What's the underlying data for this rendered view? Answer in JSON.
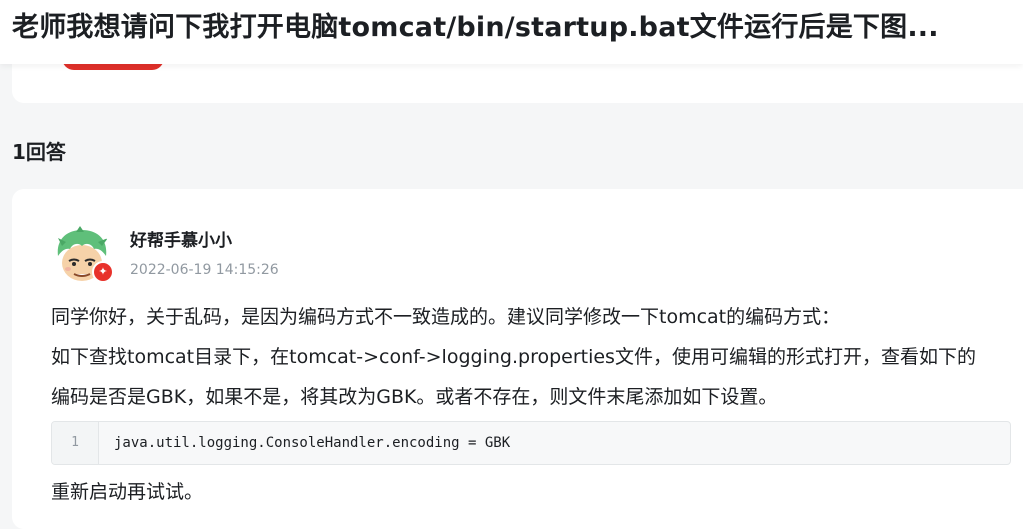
{
  "question": {
    "title": "老师我想请问下我打开电脑tomcat/bin/startup.bat文件运行后是下图..."
  },
  "answers": {
    "count_label": "1回答"
  },
  "answer": {
    "author": "好帮手慕小小",
    "time": "2022-06-19 14:15:26",
    "avatar_icon": "cartoon-avatar-icon",
    "badge_icon": "fire-badge-icon",
    "paragraphs": [
      "同学你好，关于乱码，是因为编码方式不一致造成的。建议同学修改一下tomcat的编码方式：",
      "如下查找tomcat目录下，在tomcat->conf->logging.properties文件，使用可编辑的形式打开，查看如下的",
      "编码是否是GBK，如果不是，将其改为GBK。或者不存在，则文件末尾添加如下设置。"
    ],
    "code": {
      "line_number": "1",
      "text": "java.util.logging.ConsoleHandler.encoding = GBK"
    },
    "closing": "重新启动再试试。"
  },
  "colors": {
    "accent_red": "#e0302a",
    "text": "#1c1f23",
    "muted": "#9199a1",
    "page_bg": "#f5f6f7"
  }
}
